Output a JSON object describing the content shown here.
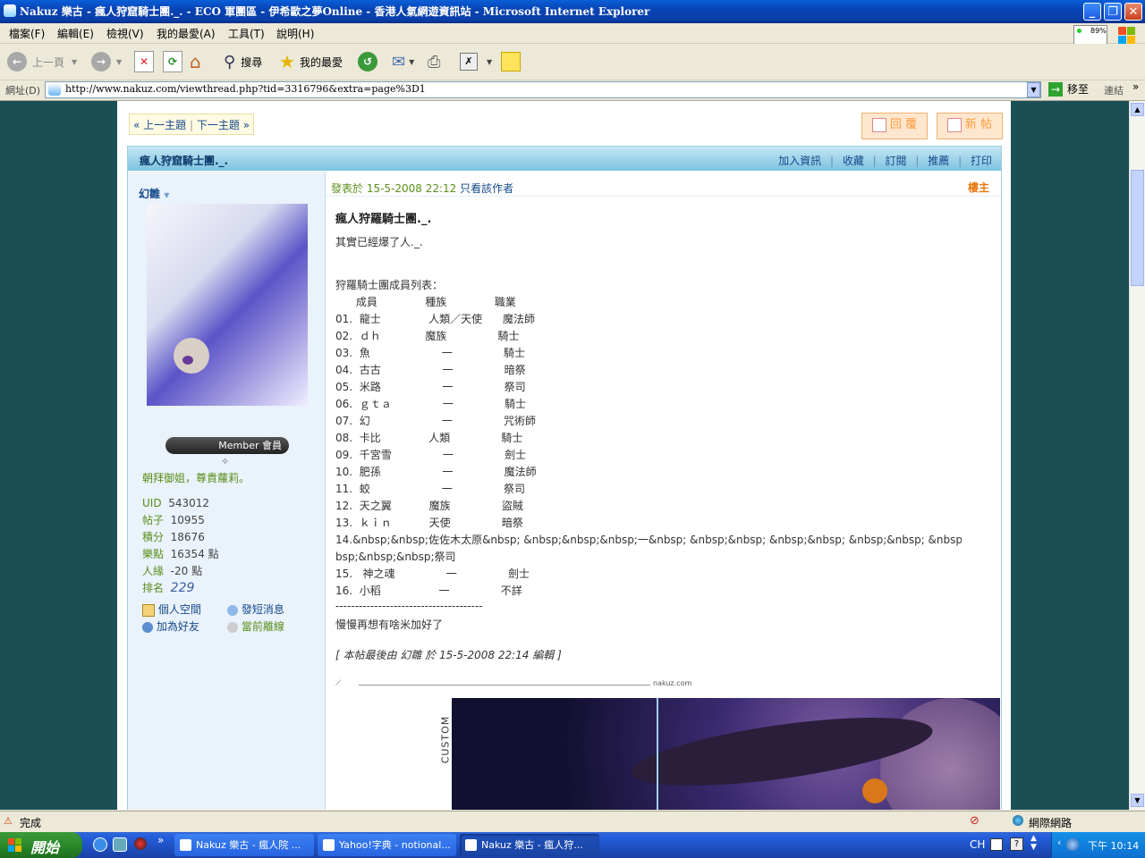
{
  "window": {
    "title": "Nakuz 樂古 - 瘋人狩窟騎士團._. - ECO 軍團區 - 伊希歐之夢Online - 香港人氣網遊資訊站 - Microsoft Internet Explorer"
  },
  "menu": [
    "檔案(F)",
    "編輯(E)",
    "檢視(V)",
    "我的最愛(A)",
    "工具(T)",
    "說明(H)"
  ],
  "toolbar": {
    "back": "上一頁",
    "search": "搜尋",
    "favorites": "我的最愛",
    "cpu": "89%"
  },
  "address": {
    "label": "網址(D)",
    "url": "http://www.nakuz.com/viewthread.php?tid=3316796&extra=page%3D1",
    "go": "移至",
    "links": "連結"
  },
  "thread_nav": {
    "prev": "上一主題",
    "sep": "|",
    "next": "下一主題"
  },
  "actions": {
    "reply": "回 覆",
    "new": "新 帖"
  },
  "header": {
    "title": "瘋人狩窟騎士團._.",
    "links": [
      "加入資訊",
      "收藏",
      "訂閱",
      "推薦",
      "打印"
    ]
  },
  "author": {
    "name": "幻雛",
    "rank": "Member 會員",
    "signature": "朝拜御姐，尊貴蘿莉。",
    "stats": [
      {
        "label": "UID",
        "value": "543012"
      },
      {
        "label": "帖子",
        "value": "10955"
      },
      {
        "label": "積分",
        "value": "18676"
      },
      {
        "label": "樂點",
        "value": "16354 點"
      },
      {
        "label": "人緣",
        "value": "-20 點"
      },
      {
        "label": "排名",
        "value": "229"
      }
    ],
    "actions": [
      "個人空間",
      "發短消息",
      "加為好友",
      "當前離線"
    ]
  },
  "post": {
    "meta": "發表於 15-5-2008 22:12",
    "only_author": "只看該作者",
    "floor": "樓主",
    "title": "瘋人狩羅騎士團._.",
    "intro": "其實已經爆了人._.",
    "list_title": "狩羅騎士團成員列表：",
    "list_header": "      成員              種族              職業",
    "rows": [
      "01.  龍士              人類／天使      魔法師",
      "02.  ｄｈ             魔族               騎士",
      "03.  魚                     一               騎士",
      "04.  古古                  一               暗祭",
      "05.  米路                  一               祭司",
      "06.  ｇｔａ               一               騎士",
      "07.  幻                     一               咒術師",
      "08.  卡比              人類               騎士",
      "09.  千宮雪               一               劍士",
      "10.  肥孫                  一               魔法師",
      "11.  蛟                     一               祭司",
      "12.  天之翼           魔族               盜賊",
      "13.  ｋｉｎ           天使               暗祭",
      "14.&nbsp;&nbsp;佐佐木太原&nbsp; &nbsp;&nbsp;&nbsp;一&nbsp; &nbsp;&nbsp; &nbsp;&nbsp; &nbsp;&nbsp; &nbsp;&nbsp; &n",
      "bsp;&nbsp;&nbsp;祭司",
      "15.   神之魂               一               劍士",
      "16.  小稻                 一               不詳"
    ],
    "divider": "--------------------------------------",
    "outro": "慢慢再想有啥米加好了",
    "edit_note": "[ 本帖最後由 幻雛 於 15-5-2008 22:14 編輯 ]",
    "sig_domain": "nakuz.com",
    "banner_text": "CUSTOM"
  },
  "status": {
    "text": "完成",
    "zone": "網際網路"
  },
  "taskbar": {
    "start": "開始",
    "tasks": [
      "Nakuz 樂古 - 瘋人院 ...",
      "Yahoo!字典 - notional...",
      "Nakuz 樂古 - 瘋人狩..."
    ],
    "lang": "CH",
    "clock": "下午 10:14"
  },
  "colors": {
    "titlebar": "#0843b4",
    "page_bg": "#1b4f56",
    "header_bar": "#7cc3e0",
    "author_bg": "#eaf2fb",
    "link": "#15498a",
    "green": "#5a8f1a",
    "orange": "#ff9a3a"
  }
}
